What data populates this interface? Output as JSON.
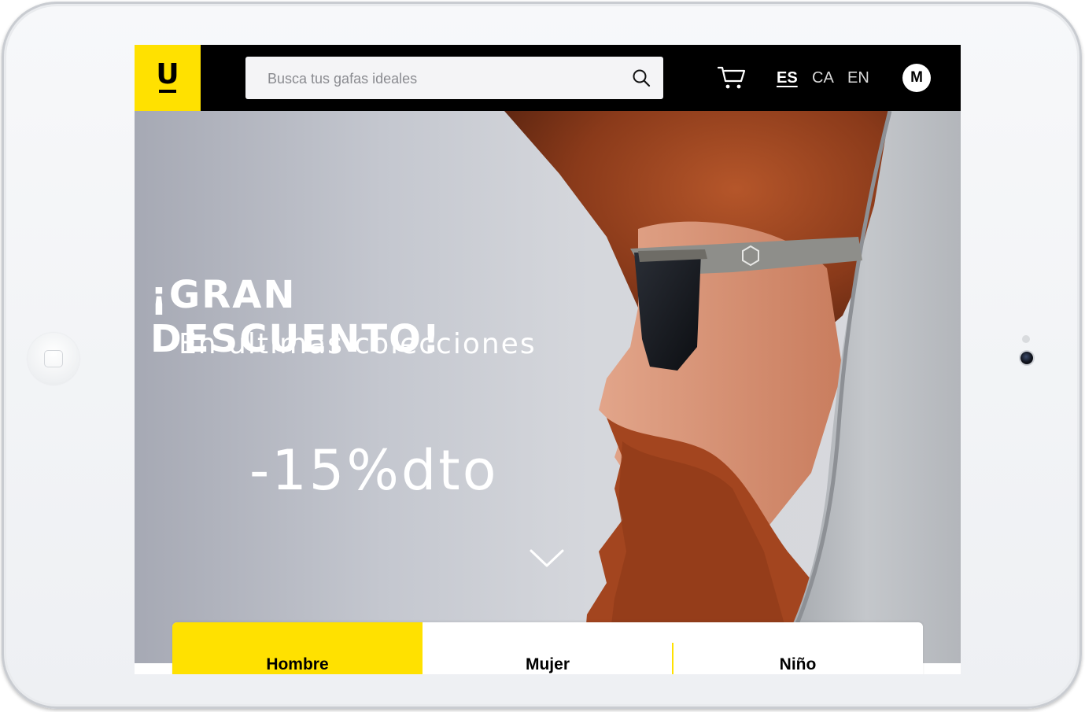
{
  "header": {
    "logo_text": "U",
    "search_placeholder": "Busca tus gafas ideales",
    "cart_icon": "cart-icon",
    "search_icon": "search-icon",
    "languages": [
      {
        "code": "ES",
        "active": true
      },
      {
        "code": "CA",
        "active": false
      },
      {
        "code": "EN",
        "active": false
      }
    ],
    "avatar_initial": "M"
  },
  "hero": {
    "title": "¡GRAN DESCUENTO!",
    "subtitle": "En ultimas colecciones",
    "discount": "-15%dto",
    "scroll_icon": "chevron-down-icon"
  },
  "categories": {
    "tabs": [
      {
        "label": "Hombre",
        "active": true
      },
      {
        "label": "Mujer",
        "active": false
      },
      {
        "label": "Niño",
        "active": false
      }
    ]
  },
  "colors": {
    "brand_yellow": "#ffe100",
    "header_bg": "#000000",
    "search_bg": "#f4f4f6"
  }
}
